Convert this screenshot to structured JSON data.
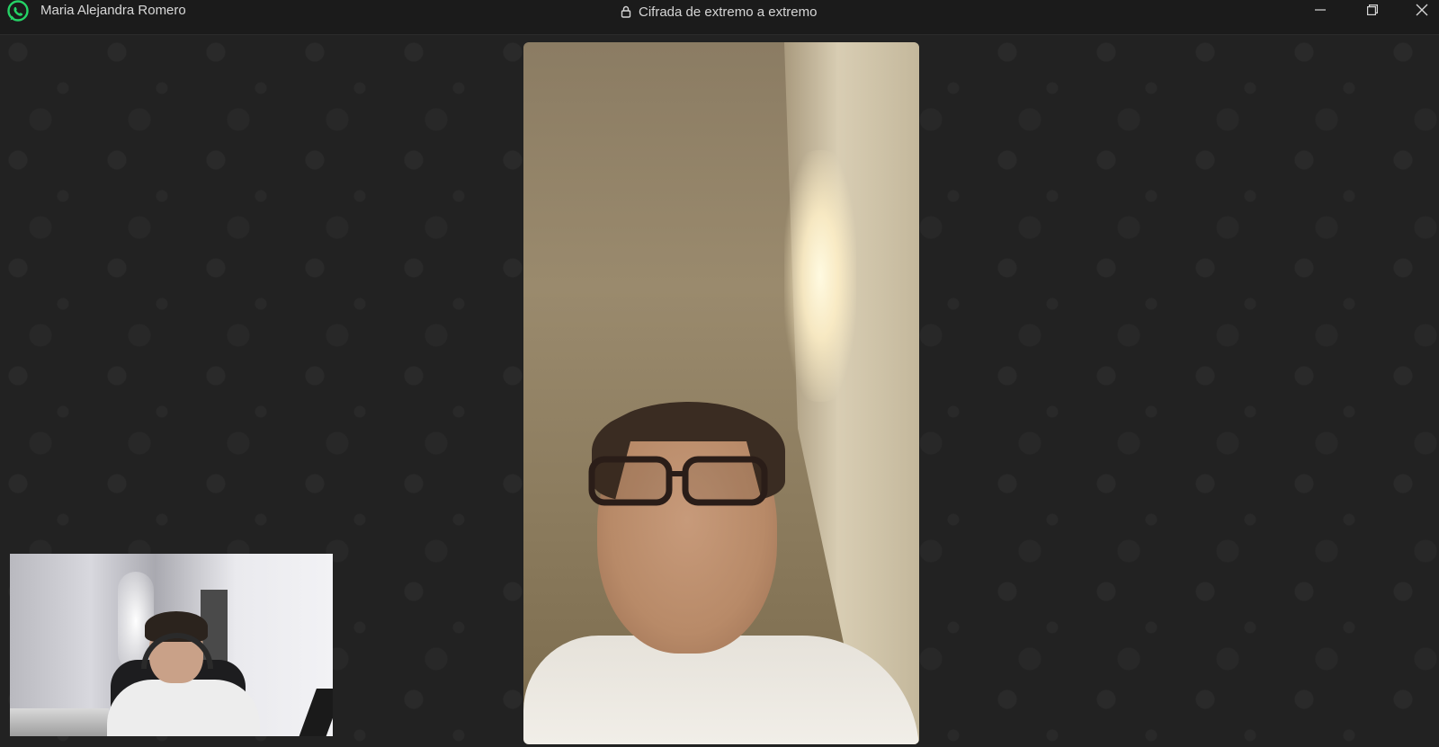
{
  "titlebar": {
    "caller_name": "Maria Alejandra Romero",
    "encryption_label": "Cifrada de extremo a extremo",
    "app_icon": "whatsapp-icon",
    "lock_icon": "lock-icon",
    "window_controls": [
      "minimize-icon",
      "restore-icon",
      "close-icon"
    ]
  },
  "colors": {
    "brand": "#25D366",
    "background": "#222222",
    "titlebar": "#1b1b1b",
    "text": "#d8d8d8"
  }
}
